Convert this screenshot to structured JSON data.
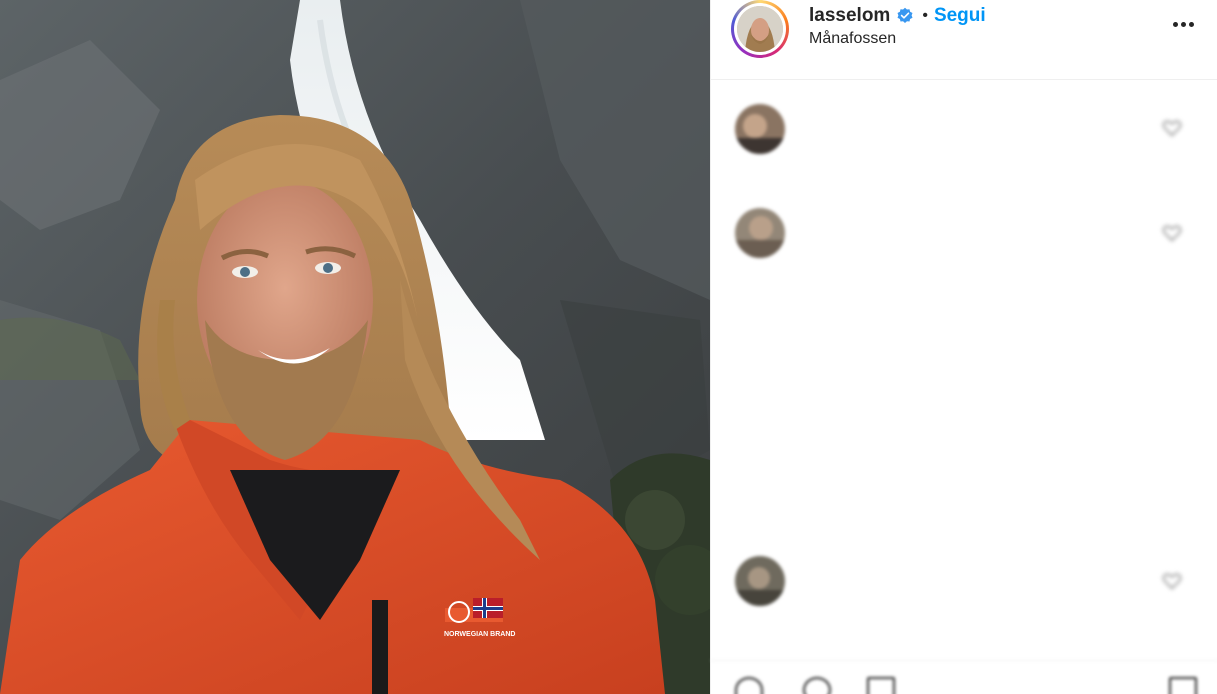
{
  "post": {
    "username": "lasselom",
    "verified": true,
    "separator": "•",
    "follow_label": "Segui",
    "location": "Månafossen"
  },
  "photo": {
    "jacket_logo": "NORWEGIAN BRAND"
  },
  "comments": [
    {
      "user": "",
      "text": "",
      "time": "",
      "reply_label": ""
    },
    {
      "user": "",
      "text": "",
      "time": "",
      "reply_label": ""
    },
    {
      "user": "",
      "text": "",
      "time": "",
      "reply_label": ""
    }
  ],
  "colors": {
    "follow_blue": "#0095f6",
    "verified_blue": "#3897f0",
    "jacket_orange": "#e2502a",
    "text_dark": "#262626",
    "meta_gray": "#8e8e8e"
  },
  "icons": {
    "verified": "verified-badge-icon",
    "more": "more-options-icon",
    "comment_like": "heart-icon",
    "actions": [
      "heart-icon",
      "comment-icon",
      "share-icon",
      "bookmark-icon"
    ]
  }
}
